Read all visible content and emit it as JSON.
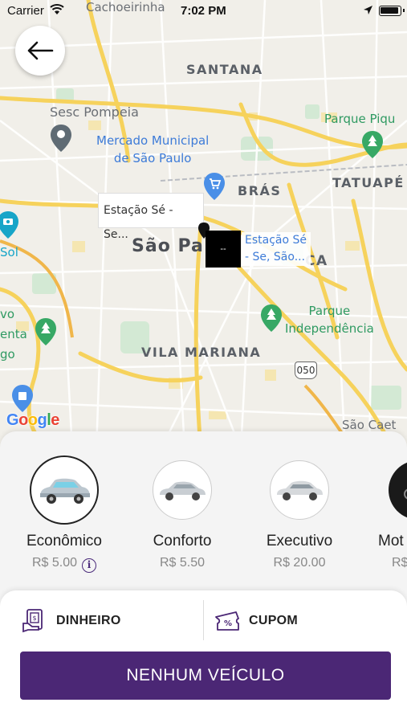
{
  "status_bar": {
    "carrier": "Carrier",
    "time": "7:02 PM"
  },
  "map": {
    "labels": {
      "cachoeirinha": "Cachoeirinha",
      "santana": "SANTANA",
      "sesc_pompeia": "Sesc Pompeia",
      "mercado_line1": "Mercado Municipal",
      "mercado_line2": "de São Paulo",
      "parque_piqueri": "Parque Piqu",
      "bras": "BRÁS",
      "tatuape": "TATUAPÉ",
      "sao_paulo": "São Pa",
      "mooca_fragment": "CA",
      "parque_line1": "Parque",
      "parque_line2": "Independência",
      "vila_mariana": "VILA MARIANA",
      "left_sol": "Sol",
      "left_vo": "vo",
      "left_enta": "enta",
      "left_go": "go",
      "road_050": "050",
      "sao_caet": "São Caet"
    },
    "marker_origin": "Estação Sé - Se...",
    "marker_dest_line1": "Estação Sé",
    "marker_dest_line2": "- Se,  São...",
    "marker_black": "--",
    "google": [
      "G",
      "o",
      "o",
      "g",
      "l",
      "e"
    ],
    "google_colors": [
      "#4285F4",
      "#EA4335",
      "#FBBC05",
      "#4285F4",
      "#34A853",
      "#EA4335"
    ]
  },
  "vehicles": [
    {
      "name": "Econômico",
      "price": "R$ 5.00",
      "selected": true
    },
    {
      "name": "Conforto",
      "price": "R$ 5.50",
      "selected": false
    },
    {
      "name": "Executivo",
      "price": "R$ 20.00",
      "selected": false
    },
    {
      "name": "Mot",
      "price": "R$",
      "selected": false
    }
  ],
  "payment": {
    "cash_label": "DINHEIRO",
    "coupon_label": "CUPOM"
  },
  "cta_label": "NENHUM VEÍCULO",
  "colors": {
    "accent": "#4b2775",
    "map_road": "#f6d25c"
  }
}
